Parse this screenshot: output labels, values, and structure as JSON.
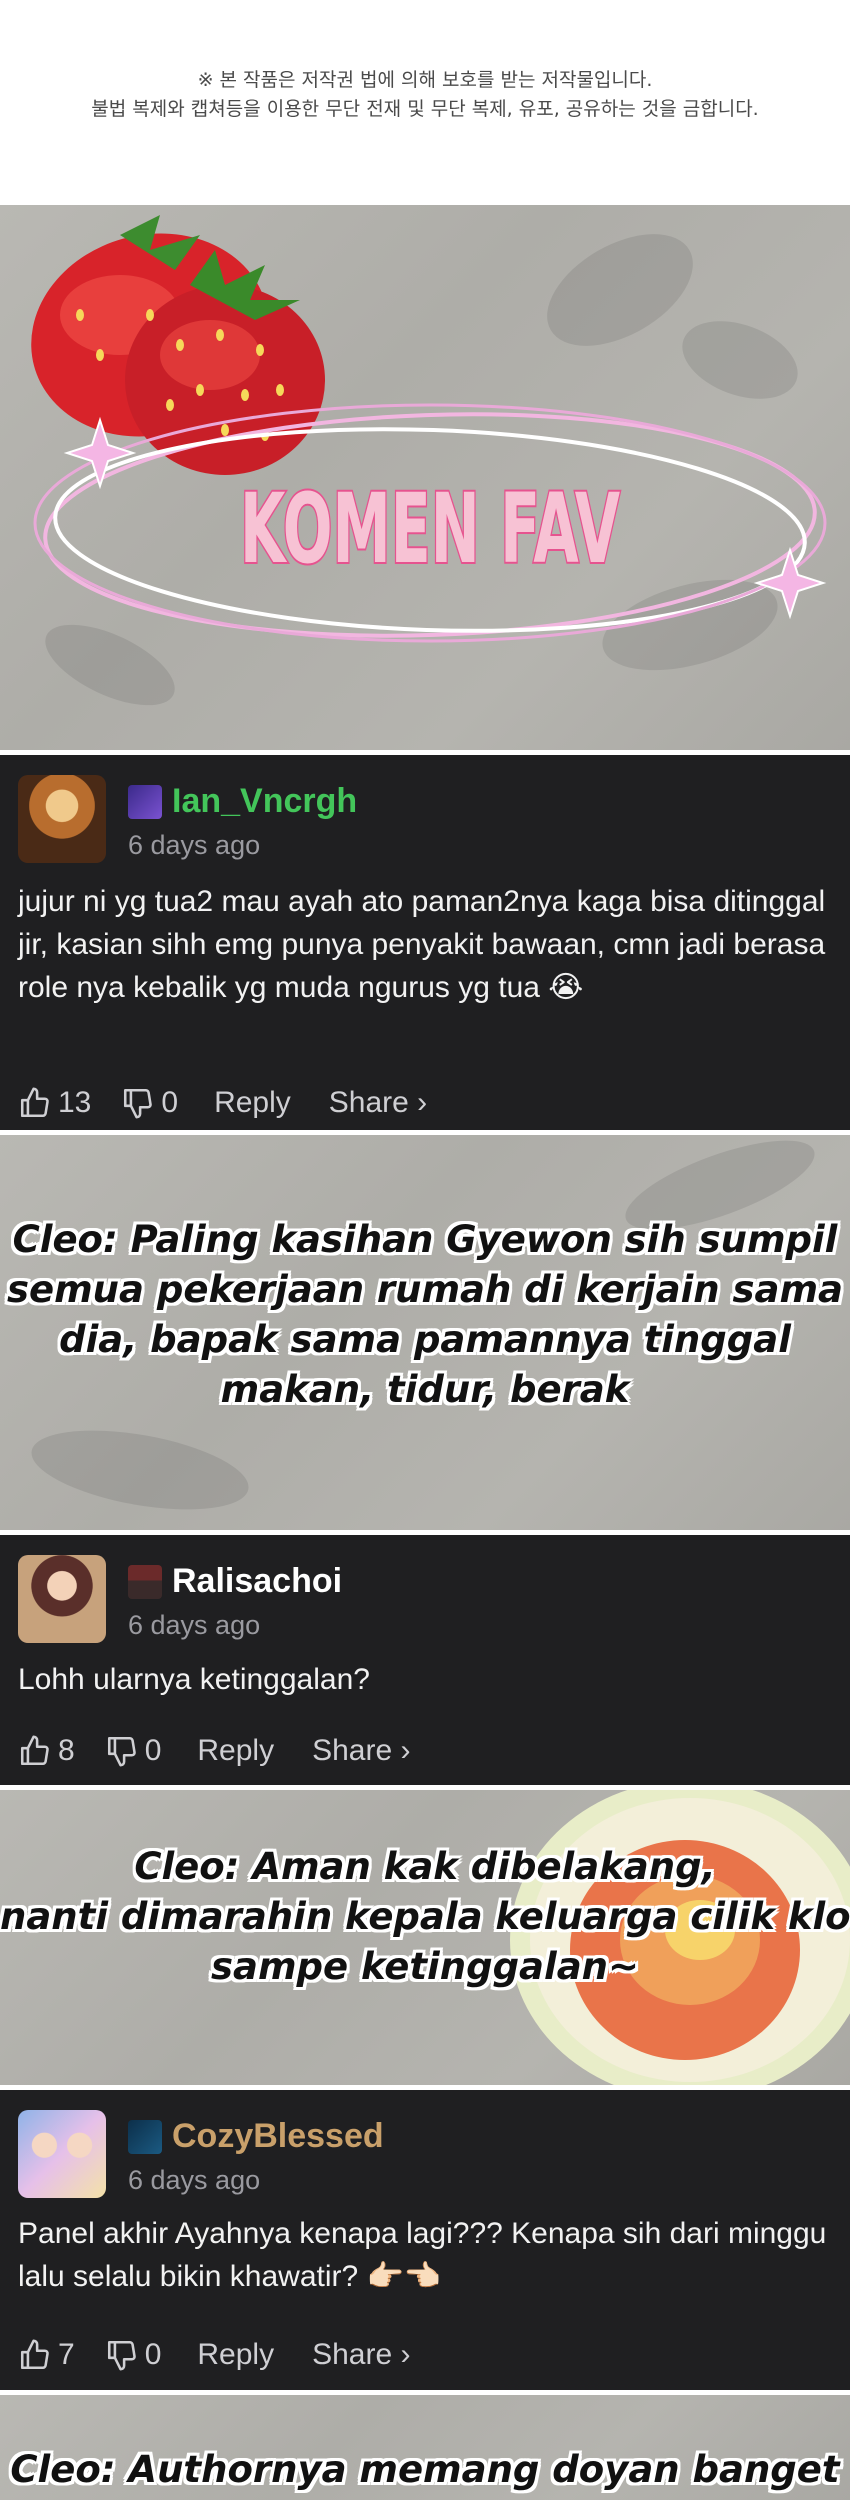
{
  "notice": {
    "line1": "※ 본 작품은 저작권 법에 의해 보호를 받는 저작물입니다.",
    "line2": "불법 복제와 캡쳐등을 이용한 무단 전재 및 무단 복제, 유포, 공유하는 것을 금합니다."
  },
  "banner": {
    "title": "KOMEN FAV",
    "icons": [
      "strawberry-icon",
      "sparkle-icon"
    ]
  },
  "comments": [
    {
      "username": "Ian_Vncrgh",
      "username_color": "#43c55a",
      "badge_icon": "wizard-badge-icon",
      "time": "6 days ago",
      "body": "jujur ni yg tua2 mau ayah ato paman2nya kaga bisa ditinggal jir, kasian sihh emg punya penyakit bawaan, cmn jadi berasa role nya kebalik yg muda ngurus yg tua 😭",
      "likes": "13",
      "dislikes": "0",
      "reply_label": "Reply",
      "share_label": "Share ›"
    },
    {
      "username": "Ralisachoi",
      "username_color": "#ffffff",
      "badge_icon": "pixel-character-badge-icon",
      "time": "6 days ago",
      "body": "Lohh ularnya ketinggalan?",
      "likes": "8",
      "dislikes": "0",
      "reply_label": "Reply",
      "share_label": "Share ›"
    },
    {
      "username": "CozyBlessed",
      "username_color": "#c9a06a",
      "badge_icon": "arabic-letter-badge-icon",
      "time": "6 days ago",
      "body": "Panel akhir Ayahnya kenapa lagi??? Kenapa sih dari minggu lalu selalu bikin khawatir? 👉🏻👈🏻",
      "likes": "7",
      "dislikes": "0",
      "reply_label": "Reply",
      "share_label": "Share ›"
    }
  ],
  "captions": [
    {
      "lines": [
        "Cleo: Paling kasihan Gyewon sih sumpil",
        "semua pekerjaan rumah di kerjain sama",
        "dia, bapak sama pamannya tinggal",
        "makan, tidur, berak"
      ]
    },
    {
      "lines": [
        "Cleo: Aman kak dibelakang,",
        "nanti dimarahin kepala keluarga cilik klo",
        "sampe ketinggalan~"
      ]
    },
    {
      "lines": [
        "Cleo: Authornya memang doyan banget"
      ]
    }
  ],
  "colors": {
    "comment_bg": "#1f1f21",
    "banner_title_fill": "#f7c2d4",
    "banner_title_outline": "#e6538f"
  }
}
